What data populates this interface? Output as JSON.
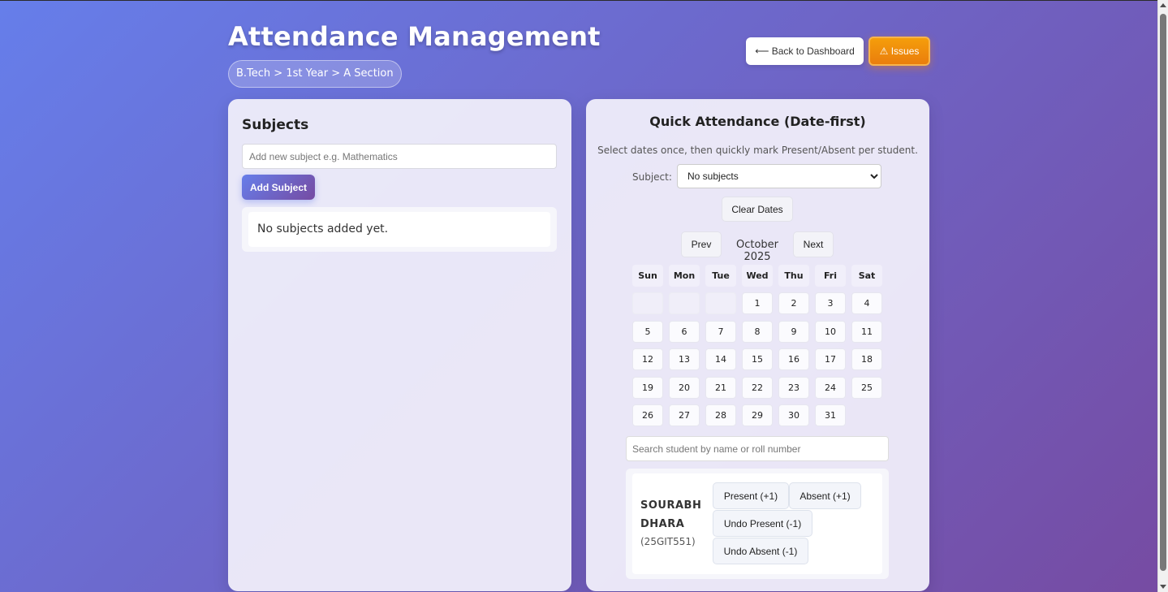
{
  "header": {
    "title": "Attendance Management",
    "breadcrumb": "B.Tech > 1st Year > A Section",
    "back_label": "⟵ Back to Dashboard",
    "issues_label": "⚠ Issues"
  },
  "subjects_panel": {
    "title": "Subjects",
    "input_placeholder": "Add new subject e.g. Mathematics",
    "add_label": "Add Subject",
    "empty_text": "No subjects added yet."
  },
  "quick_panel": {
    "title": "Quick Attendance (Date-first)",
    "description": "Select dates once, then quickly mark Present/Absent per student.",
    "subject_label": "Subject:",
    "subject_selected": "No subjects",
    "clear_label": "Clear Dates",
    "prev_label": "Prev",
    "next_label": "Next",
    "month": "October 2025",
    "weekdays": [
      "Sun",
      "Mon",
      "Tue",
      "Wed",
      "Thu",
      "Fri",
      "Sat"
    ],
    "first_weekday_index": 3,
    "days_in_month": 31,
    "search_placeholder": "Search student by name or roll number"
  },
  "student": {
    "name": "SOURABH DHARA",
    "roll": "(25GIT551)",
    "present_label": "Present (+1)",
    "absent_label": "Absent (+1)",
    "undo_present_label": "Undo Present (-1)",
    "undo_absent_label": "Undo Absent (-1)"
  },
  "colors": {
    "bg_start": "#667eea",
    "bg_end": "#764ba2",
    "issues": "#f59e0b"
  }
}
